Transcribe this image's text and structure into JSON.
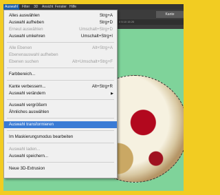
{
  "menubar": {
    "items": [
      "Auswahl",
      "Filter",
      "3D",
      "Ansicht",
      "Fenster",
      "Hilfe"
    ],
    "active_index": 0
  },
  "optionsbar": {
    "field_label": "Kante verbessern..."
  },
  "tabbar": {
    "ruler_text": "0 5 10 15 20"
  },
  "menu": {
    "items": [
      {
        "label": "Alles auswählen",
        "shortcut": "Strg+A",
        "disabled": false
      },
      {
        "label": "Auswahl aufheben",
        "shortcut": "Strg+D",
        "disabled": false
      },
      {
        "label": "Erneut auswählen",
        "shortcut": "Umschalt+Strg+D",
        "disabled": true
      },
      {
        "label": "Auswahl umkehren",
        "shortcut": "Umschalt+Strg+I",
        "disabled": false
      },
      {
        "label": "Alle Ebenen",
        "shortcut": "Alt+Strg+A",
        "disabled": true
      },
      {
        "label": "Ebenenauswahl aufheben",
        "shortcut": "",
        "disabled": true
      },
      {
        "label": "Ebenen suchen",
        "shortcut": "Alt+Umschalt+Strg+F",
        "disabled": true
      },
      {
        "label": "Farbbereich...",
        "shortcut": "",
        "disabled": false
      },
      {
        "label": "Kante verbessern...",
        "shortcut": "Alt+Strg+R",
        "disabled": false
      },
      {
        "label": "Auswahl verändern",
        "shortcut": "",
        "disabled": false,
        "submenu": true
      },
      {
        "label": "Auswahl vergrößern",
        "shortcut": "",
        "disabled": false
      },
      {
        "label": "Ähnliches auswählen",
        "shortcut": "",
        "disabled": false
      },
      {
        "label": "Auswahl transformieren",
        "shortcut": "",
        "disabled": false,
        "highlighted": true
      },
      {
        "label": "Im Maskierungsmodus bearbeiten",
        "shortcut": "",
        "disabled": false
      },
      {
        "label": "Auswahl laden...",
        "shortcut": "",
        "disabled": true
      },
      {
        "label": "Auswahl speichern...",
        "shortcut": "",
        "disabled": false
      },
      {
        "label": "Neue 3D-Extrusion",
        "shortcut": "",
        "disabled": false
      }
    ]
  },
  "colors": {
    "highlight": "#3a7bd5",
    "canvas_green": "#7fd39a",
    "frame_yellow": "#f2cc22"
  }
}
